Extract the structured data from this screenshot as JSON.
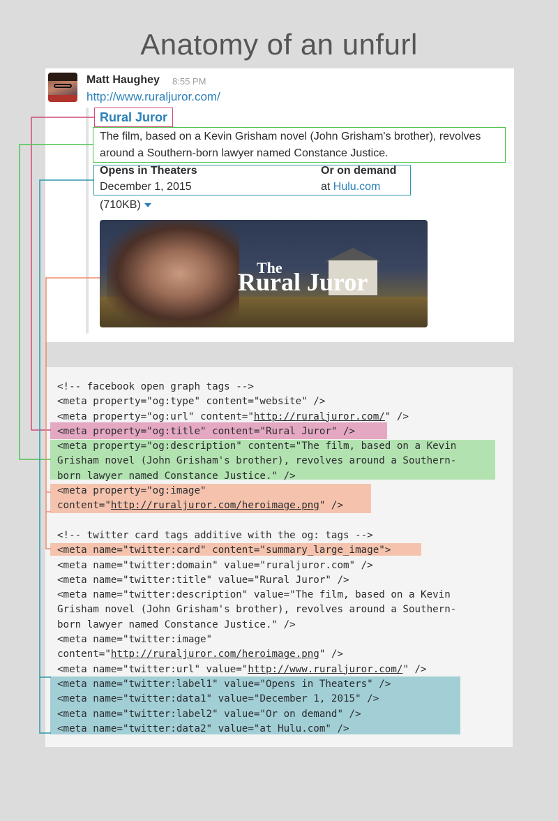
{
  "page_title": "Anatomy of an unfurl",
  "message": {
    "sender": "Matt Haughey",
    "time": "8:55 PM",
    "link": "http://www.ruraljuror.com/"
  },
  "unfurl": {
    "title": "Rural Juror",
    "description": "The film, based on a Kevin Grisham novel (John Grisham's brother), revolves around a Southern-born lawyer named Constance Justice.",
    "fields": [
      {
        "label": "Opens in Theaters",
        "value": "December 1, 2015"
      },
      {
        "label": "Or on demand",
        "value_prefix": "at ",
        "value_link": "Hulu.com"
      }
    ],
    "file_size": "(710KB)",
    "hero_text_small": "The",
    "hero_text_large": "Rural Juror"
  },
  "code_lines": [
    "<!-- facebook open graph tags -->",
    "<meta property=\"og:type\" content=\"website\" />",
    [
      "<meta property=\"og:url\" content=\"",
      "http://ruraljuror.com/",
      "\" />"
    ],
    "<meta property=\"og:title\" content=\"Rural Juror\" />",
    "<meta property=\"og:description\" content=\"The film, based on a Kevin",
    "Grisham novel (John Grisham's brother), revolves around a Southern-",
    "born lawyer named Constance Justice.\" />",
    "<meta property=\"og:image\"",
    [
      "content=\"",
      "http://ruraljuror.com/heroimage.png",
      "\" />"
    ],
    "",
    "<!-- twitter card tags additive with the og: tags -->",
    "<meta name=\"twitter:card\" content=\"summary_large_image\">",
    "<meta name=\"twitter:domain\" value=\"ruraljuror.com\" />",
    "<meta name=\"twitter:title\" value=\"Rural Juror\" />",
    "<meta name=\"twitter:description\" value=\"The film, based on a Kevin",
    "Grisham novel (John Grisham's brother), revolves around a Southern-",
    "born lawyer named Constance Justice.\" />",
    "<meta name=\"twitter:image\"",
    [
      "content=\"",
      "http://ruraljuror.com/heroimage.png",
      "\" />"
    ],
    [
      "<meta name=\"twitter:url\" value=\"",
      "http://www.ruraljuror.com/",
      "\" />"
    ],
    "<meta name=\"twitter:label1\" value=\"Opens in Theaters\" />",
    "<meta name=\"twitter:data1\" value=\"December 1, 2015\" />",
    "<meta name=\"twitter:label2\" value=\"Or on demand\" />",
    "<meta name=\"twitter:data2\" value=\"at Hulu.com\" />"
  ],
  "colors": {
    "title_link": "#2a80b9",
    "annotation_pink": "#d04a7c",
    "annotation_green": "#4cc44c",
    "annotation_blue": "#2a98a8",
    "annotation_salmon": "#f08a6a"
  }
}
